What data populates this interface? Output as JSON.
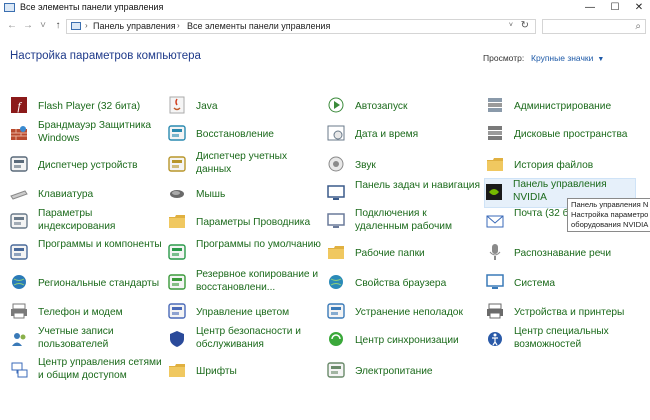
{
  "window": {
    "title": "Все элементы панели управления",
    "minimize": "—",
    "maximize": "☐",
    "close": "✕"
  },
  "address": {
    "crumb1": "Панель управления",
    "crumb2": "Все элементы панели управления",
    "separator": "›",
    "dropdown": "˅",
    "refresh": "↻"
  },
  "nav": {
    "back": "←",
    "forward": "→",
    "recent": "˅",
    "up": "↑"
  },
  "search": {
    "icon": "⌕"
  },
  "main": {
    "heading": "Настройка параметров компьютера",
    "view_label": "Просмотр:",
    "view_value": "Крупные значки",
    "view_arrow": "▼"
  },
  "items": [
    {
      "label": "Flash Player (32 бита)",
      "icon": "flash-player-icon",
      "color": "#8b1a1a"
    },
    {
      "label": "Брандмауэр Защитника Windows",
      "icon": "firewall-icon",
      "color": "#b84a2e"
    },
    {
      "label": "Диспетчер устройств",
      "icon": "device-manager-icon",
      "color": "#5a6a7a"
    },
    {
      "label": "Клавиатура",
      "icon": "keyboard-icon",
      "color": "#8a8a8a"
    },
    {
      "label": "Параметры индексирования",
      "icon": "indexing-icon",
      "color": "#6a7a8a"
    },
    {
      "label": "Программы и компоненты",
      "icon": "programs-icon",
      "color": "#4a6a9a"
    },
    {
      "label": "Региональные стандарты",
      "icon": "region-icon",
      "color": "#2a7ab8"
    },
    {
      "label": "Телефон и модем",
      "icon": "phone-modem-icon",
      "color": "#7a7a7a"
    },
    {
      "label": "Учетные записи пользователей",
      "icon": "user-accounts-icon",
      "color": "#3a7ab8"
    },
    {
      "label": "Центр управления сетями и общим доступом",
      "icon": "network-center-icon",
      "color": "#3a6ab8"
    },
    {
      "label": "Java",
      "icon": "java-icon",
      "color": "#c05a2a"
    },
    {
      "label": "Восстановление",
      "icon": "recovery-icon",
      "color": "#2a8ab0"
    },
    {
      "label": "Диспетчер учетных данных",
      "icon": "credential-manager-icon",
      "color": "#b8962a"
    },
    {
      "label": "Мышь",
      "icon": "mouse-icon",
      "color": "#6a6a6a"
    },
    {
      "label": "Параметры Проводника",
      "icon": "explorer-options-icon",
      "color": "#e0b040"
    },
    {
      "label": "Программы по умолчанию",
      "icon": "default-programs-icon",
      "color": "#2a9a4a"
    },
    {
      "label": "Резервное копирование и восстановлени...",
      "icon": "backup-icon",
      "color": "#3a9a3a"
    },
    {
      "label": "Управление цветом",
      "icon": "color-management-icon",
      "color": "#4a6ab8"
    },
    {
      "label": "Центр безопасности и обслуживания",
      "icon": "security-center-icon",
      "color": "#2a4a9a"
    },
    {
      "label": "Шрифты",
      "icon": "fonts-icon",
      "color": "#e0b040"
    },
    {
      "label": "Автозапуск",
      "icon": "autoplay-icon",
      "color": "#3a8a3a"
    },
    {
      "label": "Дата и время",
      "icon": "date-time-icon",
      "color": "#6a7a8a"
    },
    {
      "label": "Звук",
      "icon": "sound-icon",
      "color": "#8a8a8a"
    },
    {
      "label": "Панель задач и навигация",
      "icon": "taskbar-icon",
      "color": "#3a5a8a"
    },
    {
      "label": "Подключения к удаленным рабочим",
      "icon": "remote-connections-icon",
      "color": "#6a7a9a"
    },
    {
      "label": "Рабочие папки",
      "icon": "work-folders-icon",
      "color": "#e0b040"
    },
    {
      "label": "Свойства браузера",
      "icon": "browser-properties-icon",
      "color": "#2a8ab8"
    },
    {
      "label": "Устранение неполадок",
      "icon": "troubleshooting-icon",
      "color": "#3a7ab8"
    },
    {
      "label": "Центр синхронизации",
      "icon": "sync-center-icon",
      "color": "#3aa83a"
    },
    {
      "label": "Электропитание",
      "icon": "power-options-icon",
      "color": "#6a8a6a"
    },
    {
      "label": "Администрирование",
      "icon": "administration-icon",
      "color": "#8a9aaa"
    },
    {
      "label": "Дисковые пространства",
      "icon": "storage-spaces-icon",
      "color": "#7a7a7a"
    },
    {
      "label": "История файлов",
      "icon": "file-history-icon",
      "color": "#e0b040"
    },
    {
      "label": "Панель управления NVIDIA",
      "icon": "nvidia-icon",
      "color": "#76b900"
    },
    {
      "label": "Почта (32 бита)",
      "icon": "mail-icon",
      "color": "#3a6ab8"
    },
    {
      "label": "Распознавание речи",
      "icon": "speech-recognition-icon",
      "color": "#8a8a8a"
    },
    {
      "label": "Система",
      "icon": "system-icon",
      "color": "#3a7ab8"
    },
    {
      "label": "Устройства и принтеры",
      "icon": "devices-printers-icon",
      "color": "#6a6a6a"
    },
    {
      "label": "Центр специальных возможностей",
      "icon": "accessibility-icon",
      "color": "#2a5aa8"
    }
  ],
  "tooltip": {
    "line1": "Панель управления N",
    "line2": "Настройка параметро",
    "line3": "оборудования NVIDIA"
  }
}
